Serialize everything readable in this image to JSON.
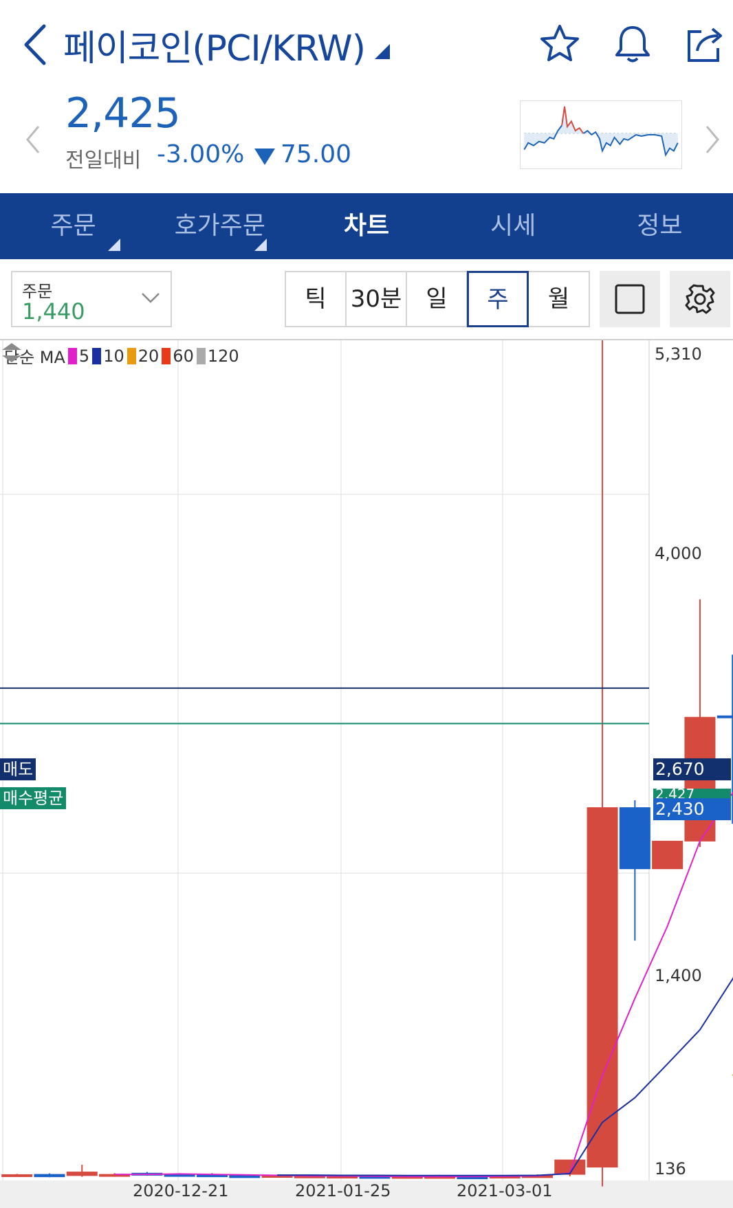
{
  "header": {
    "title": "페이코인(PCI/KRW)",
    "icons": [
      "back-arrow-icon",
      "star-icon",
      "bell-icon",
      "share-icon"
    ]
  },
  "quote": {
    "price": "2,425",
    "change_label": "전일대비",
    "change_pct": "-3.00%",
    "change_amt": "75.00",
    "down_color": "#1b62b8"
  },
  "tabs": [
    {
      "label": "주문"
    },
    {
      "label": "호가주문"
    },
    {
      "label": "차트"
    },
    {
      "label": "시세"
    },
    {
      "label": "정보"
    }
  ],
  "toolbar": {
    "order_label": "주문",
    "order_value": "1,440",
    "periods": [
      "틱",
      "30분",
      "일",
      "주",
      "월"
    ],
    "selected_period": "주"
  },
  "chart_data": {
    "type": "candlestick",
    "legend": {
      "prefix": "단순 MA",
      "items": [
        {
          "label": "5",
          "color": "#e020c8"
        },
        {
          "label": "10",
          "color": "#1a30a0"
        },
        {
          "label": "20",
          "color": "#e89a10"
        },
        {
          "label": "60",
          "color": "#e83a1a"
        },
        {
          "label": "120",
          "color": "#aaaaaa"
        }
      ]
    },
    "y_ticks": [
      "5,310",
      "4,000",
      "1,400",
      "136"
    ],
    "x_ticks": [
      "2020-12-21",
      "2021-01-25",
      "2021-03-01"
    ],
    "candles": [
      {
        "o": 148,
        "h": 152,
        "l": 144,
        "c": 149
      },
      {
        "o": 150,
        "h": 154,
        "l": 138,
        "c": 140
      },
      {
        "o": 145,
        "h": 190,
        "l": 140,
        "c": 160
      },
      {
        "o": 148,
        "h": 155,
        "l": 140,
        "c": 150
      },
      {
        "o": 155,
        "h": 160,
        "l": 145,
        "c": 152
      },
      {
        "o": 150,
        "h": 155,
        "l": 142,
        "c": 148
      },
      {
        "o": 150,
        "h": 155,
        "l": 145,
        "c": 140
      },
      {
        "o": 145,
        "h": 150,
        "l": 138,
        "c": 142
      },
      {
        "o": 142,
        "h": 148,
        "l": 138,
        "c": 146
      },
      {
        "o": 142,
        "h": 148,
        "l": 136,
        "c": 144
      },
      {
        "o": 140,
        "h": 146,
        "l": 136,
        "c": 143
      },
      {
        "o": 142,
        "h": 145,
        "l": 136,
        "c": 140
      },
      {
        "o": 140,
        "h": 145,
        "l": 136,
        "c": 142
      },
      {
        "o": 140,
        "h": 148,
        "l": 136,
        "c": 142
      },
      {
        "o": 140,
        "h": 145,
        "l": 136,
        "c": 138
      },
      {
        "o": 142,
        "h": 146,
        "l": 138,
        "c": 143
      },
      {
        "o": 145,
        "h": 150,
        "l": 140,
        "c": 145
      },
      {
        "o": 150,
        "h": 160,
        "l": 142,
        "c": 210
      },
      {
        "o": 180,
        "h": 5310,
        "l": 100,
        "c": 1850
      },
      {
        "o": 1850,
        "h": 1900,
        "l": 1120,
        "c": 1430
      },
      {
        "o": 1430,
        "h": 1520,
        "l": 1430,
        "c": 1620
      },
      {
        "o": 1620,
        "h": 3280,
        "l": 1580,
        "c": 2470
      },
      {
        "o": 2480,
        "h": 2900,
        "l": 1740,
        "c": 2470
      },
      {
        "o": 2420,
        "h": 2550,
        "l": 2310,
        "c": 2425
      }
    ],
    "ma5": [
      null,
      null,
      null,
      null,
      150,
      150,
      152,
      150,
      148,
      146,
      144,
      143,
      142,
      141,
      141,
      141,
      142,
      144,
      155,
      560,
      880,
      1180,
      1620,
      1950,
      2060
    ],
    "ma10": [
      null,
      null,
      null,
      null,
      null,
      null,
      null,
      null,
      null,
      147,
      147,
      146,
      146,
      145,
      145,
      145,
      145,
      146,
      153,
      366,
      468,
      608,
      750,
      960,
      1200
    ],
    "ma20": [
      null,
      null,
      null,
      null,
      null,
      null,
      null,
      null,
      null,
      null,
      null,
      null,
      null,
      null,
      null,
      null,
      null,
      null,
      null,
      null,
      null,
      null,
      null,
      560,
      715
    ],
    "bid_price": "2,670",
    "avg_buy_price": "2,427",
    "current_price": "2,430",
    "sell_label": "매도",
    "avg_label": "매수평균",
    "up_color": "#d44a3f",
    "down_color": "#1b62c8"
  }
}
